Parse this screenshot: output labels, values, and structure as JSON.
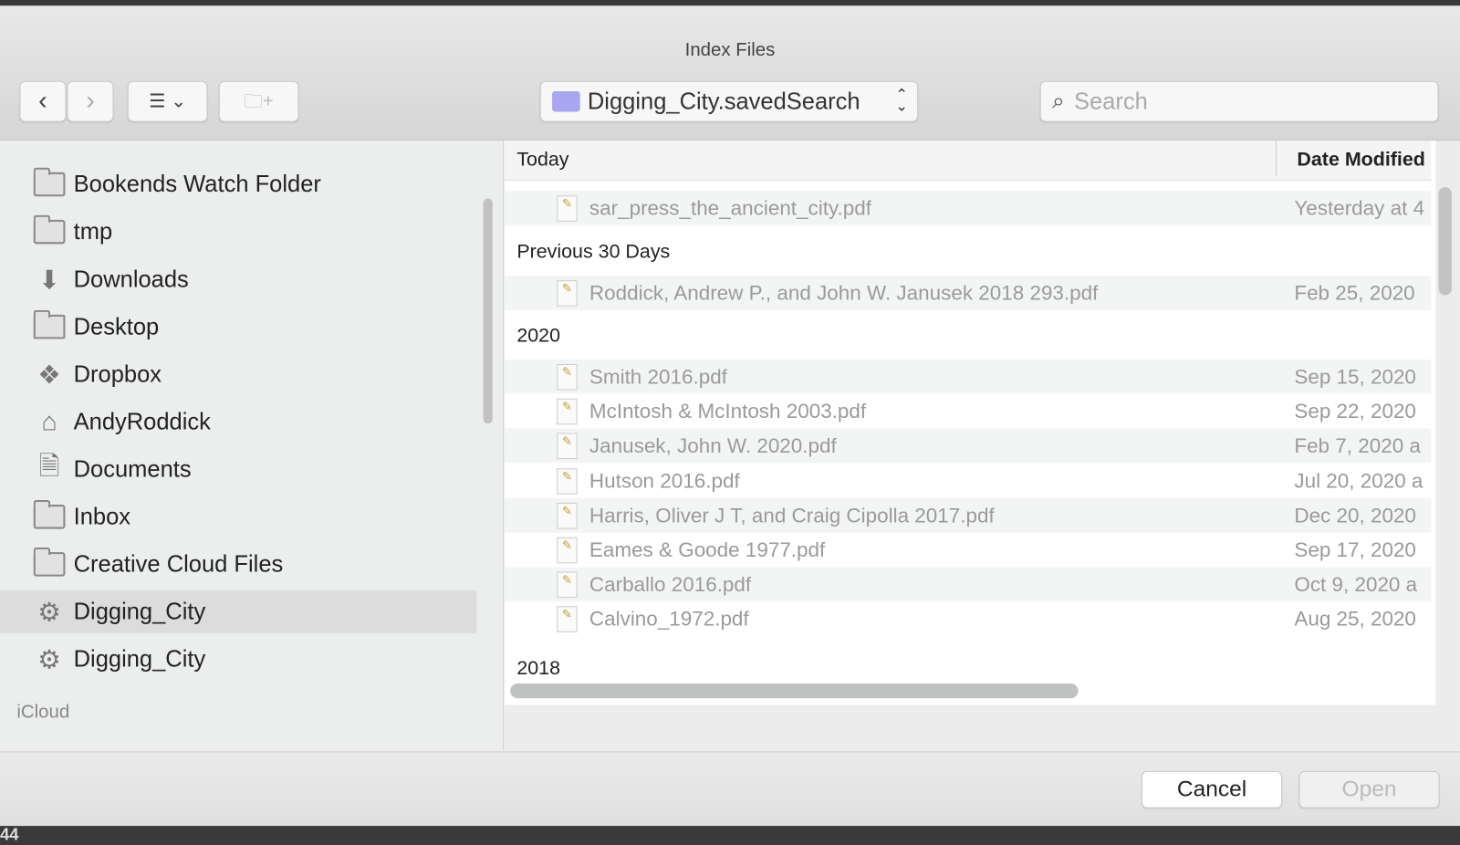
{
  "window": {
    "title": "Index Files"
  },
  "toolbar": {
    "location": "Digging_City.savedSearch",
    "search_placeholder": "Search"
  },
  "sidebar": {
    "items": [
      {
        "label": "Bookends Watch Folder",
        "icon": "folder-icon"
      },
      {
        "label": "tmp",
        "icon": "folder-icon"
      },
      {
        "label": "Downloads",
        "icon": "download-icon"
      },
      {
        "label": "Desktop",
        "icon": "desktop-icon"
      },
      {
        "label": "Dropbox",
        "icon": "dropbox-icon"
      },
      {
        "label": "AndyRoddick",
        "icon": "home-icon"
      },
      {
        "label": "Documents",
        "icon": "documents-icon"
      },
      {
        "label": "Inbox",
        "icon": "folder-icon"
      },
      {
        "label": "Creative Cloud Files",
        "icon": "folder-icon"
      },
      {
        "label": "Digging_City",
        "icon": "gear-icon",
        "selected": true
      },
      {
        "label": "Digging_City",
        "icon": "gear-icon"
      }
    ],
    "section_icloud": "iCloud"
  },
  "list": {
    "col_name": "Today",
    "col_date": "Date Modified",
    "groups": [
      {
        "label": "Previous 30 Days"
      },
      {
        "label": "2020"
      },
      {
        "label": "2018"
      }
    ],
    "rows": [
      {
        "name": "sar_press_the_ancient_city.pdf",
        "date": "Yesterday at 4"
      },
      {
        "name": "Roddick, Andrew P., and John W. Janusek 2018 293.pdf",
        "date": "Feb 25, 2020"
      },
      {
        "name": "Smith 2016.pdf",
        "date": "Sep 15, 2020"
      },
      {
        "name": "McIntosh & McIntosh 2003.pdf",
        "date": "Sep 22, 2020"
      },
      {
        "name": "Janusek, John W. 2020.pdf",
        "date": "Feb 7, 2020 a"
      },
      {
        "name": "Hutson 2016.pdf",
        "date": "Jul 20, 2020 a"
      },
      {
        "name": "Harris, Oliver J T, and Craig Cipolla 2017.pdf",
        "date": "Dec 20, 2020"
      },
      {
        "name": "Eames & Goode 1977.pdf",
        "date": "Sep 17, 2020"
      },
      {
        "name": "Carballo 2016.pdf",
        "date": "Oct 9, 2020 a"
      },
      {
        "name": "Calvino_1972.pdf",
        "date": "Aug 25, 2020"
      }
    ]
  },
  "footer": {
    "cancel": "Cancel",
    "open": "Open"
  },
  "background": {
    "text": "44"
  }
}
